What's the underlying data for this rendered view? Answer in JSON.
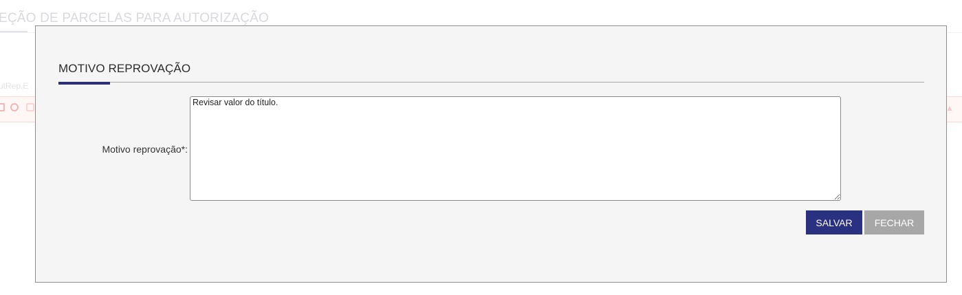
{
  "background": {
    "title": "EÇÃO DE PARCELAS PARA AUTORIZAÇÃO",
    "id_fragment": "utRep.E"
  },
  "modal": {
    "section_title": "MOTIVO REPROVAÇÃO",
    "field_label": "Motivo reprovação*:",
    "field_value": "Revisar valor do título.",
    "save_label": "SALVAR",
    "close_label": "FECHAR"
  },
  "colors": {
    "primary": "#2b3181",
    "secondary_button": "#a7a7a7",
    "modal_background": "#f5f5f5"
  }
}
